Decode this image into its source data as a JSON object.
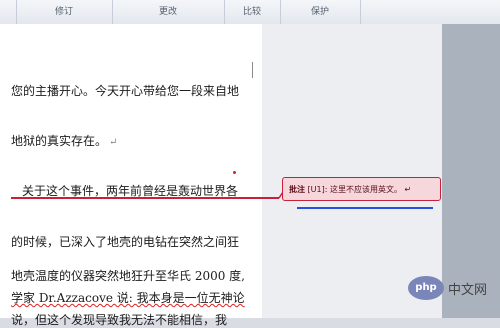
{
  "ribbon": {
    "groups": [
      "",
      "修订",
      "更改",
      "比较",
      "保护"
    ]
  },
  "document": {
    "lines": [
      "您的主播开心。今天开心带给您一段来自地",
      "地狱的真实存在。",
      "关于这个事件，两年前曾经是轰动世界各",
      "的时候，已深入了地壳的电钻在突然之间狂",
      "地壳温度的仪器突然地狂升至华氏 2000 度,",
      "学家 Dr.Azzacove 说: 我本身是一位无神论",
      "说，但这个发现导致我无法不能相信，我"
    ],
    "paragraph_mark": "↵"
  },
  "comment": {
    "tag": "批注",
    "ref": "[U1]:",
    "text": "这里不应该用英文。",
    "mark": "↵"
  },
  "watermark": {
    "logo_text": "php",
    "site_text": "中文网"
  },
  "colors": {
    "comment_border": "#c8203a",
    "comment_fill": "#f6d7dc",
    "highlight_underline": "#2b4ddf"
  }
}
